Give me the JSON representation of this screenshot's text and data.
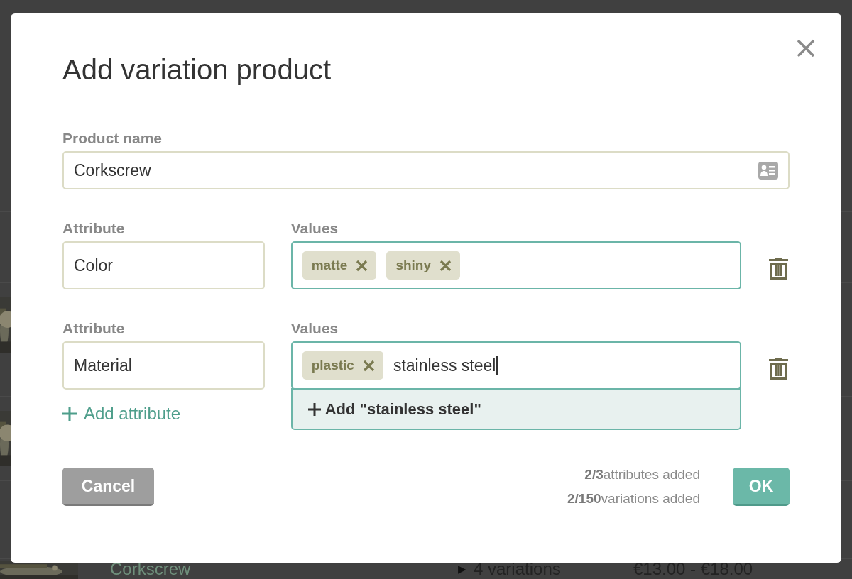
{
  "background_row": {
    "name": "Corkscrew",
    "toggle": "▶",
    "variations": "4 variations",
    "price": "€13.00 - €18.00"
  },
  "modal": {
    "title": "Add variation product",
    "product_name": {
      "label": "Product name",
      "value": "Corkscrew"
    },
    "attributes": [
      {
        "label": "Attribute",
        "value": "Color",
        "values_label": "Values",
        "tags": [
          "matte",
          "shiny"
        ]
      },
      {
        "label": "Attribute",
        "value": "Material",
        "values_label": "Values",
        "tags": [
          "plastic"
        ],
        "typed": "stainless steel",
        "suggestion": "Add \"stainless steel\""
      }
    ],
    "add_attribute": "Add attribute",
    "cancel": "Cancel",
    "stats": [
      "**2/3**attributes added",
      "**2/150**variations added"
    ],
    "ok": "OK"
  }
}
